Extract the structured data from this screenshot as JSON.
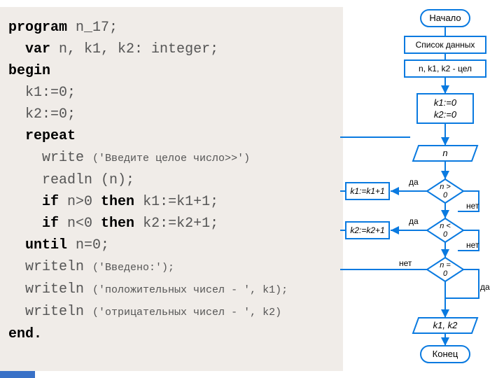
{
  "code": {
    "l1_kw": "program",
    "l1_rest": " n_17;",
    "l2_kw": "var",
    "l2_rest": " n, k1, k2: integer;",
    "l3_kw": "begin",
    "l4": "  k1:=0;",
    "l5": "  k2:=0;",
    "l6_kw": "repeat",
    "l7a": "    write ",
    "l7b": "('Введите целое число>>')",
    "l8": "    readln (n);",
    "l9a": "if",
    "l9b": " n>0 ",
    "l9c": "then",
    "l9d": " k1:=k1+1;",
    "l10a": "if",
    "l10b": " n<0 ",
    "l10c": "then",
    "l10d": " k2:=k2+1;",
    "l11a": "until",
    "l11b": " n=0;",
    "l12a": "  writeln ",
    "l12b": "('Введено:');",
    "l13a": "  writeln ",
    "l13b": "('положительных чисел - ', k1);",
    "l14a": "  writeln ",
    "l14b": "('отрицательных чисел - ', k2)",
    "l15_kw": "end."
  },
  "flow": {
    "start": "Начало",
    "datalist": "Список данных",
    "vars1": "n, k1, k2",
    "vars2": " - цел",
    "init1": "k1:=0",
    "init2": "k2:=0",
    "input": "n",
    "cond1a": "n >",
    "cond1b": "0",
    "cond2a": "n <",
    "cond2b": "0",
    "cond3a": "n =",
    "cond3b": "0",
    "act1": "k1:=k1+1",
    "act2": "k2:=k2+1",
    "output": "k1, k2",
    "end": "Конец",
    "yes": "да",
    "no": "нет"
  }
}
